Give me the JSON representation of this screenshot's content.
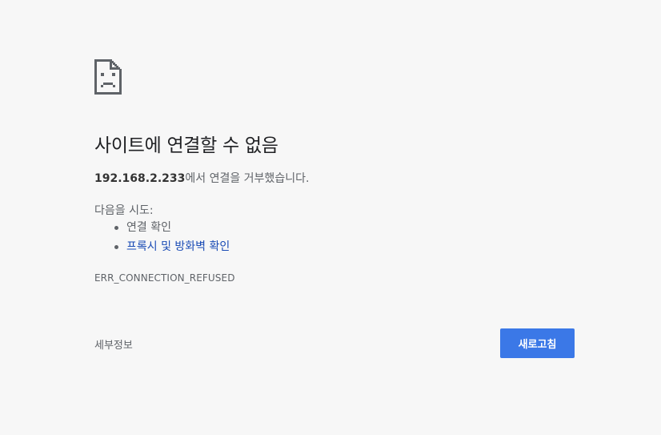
{
  "error": {
    "icon": "sad-page-icon",
    "title": "사이트에 연결할 수 없음",
    "host": "192.168.2.233",
    "description_suffix": "에서 연결을 거부했습니다.",
    "try_label": "다음을 시도:",
    "suggestions": [
      {
        "label": "연결 확인",
        "is_link": false
      },
      {
        "label": "프록시 및 방화벽 확인",
        "is_link": true
      }
    ],
    "code": "ERR_CONNECTION_REFUSED"
  },
  "actions": {
    "details_label": "세부정보",
    "reload_label": "새로고침"
  },
  "colors": {
    "background": "#f7f7f7",
    "primary_button": "#3b78e7",
    "link": "#1a4bb5",
    "text": "#5f6368"
  }
}
